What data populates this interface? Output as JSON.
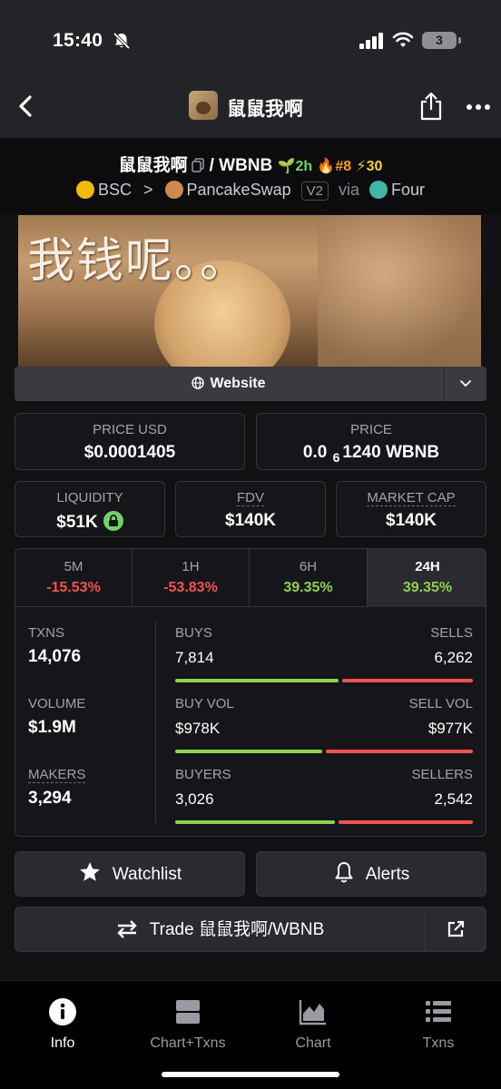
{
  "status_bar": {
    "time": "15:40",
    "battery": "3"
  },
  "nav": {
    "title": "鼠鼠我啊"
  },
  "pair": {
    "token": "鼠鼠我啊",
    "separator": "/",
    "quote": "WBNB",
    "age": "2h",
    "rank": "#8",
    "boosts": "30",
    "chain": "BSC",
    "chevron": ">",
    "dex": "PancakeSwap",
    "dex_version": "V2",
    "via_label": "via",
    "launchpad": "Four"
  },
  "banner": {
    "text": "我钱呢。。"
  },
  "website": {
    "label": "Website"
  },
  "stats": {
    "price_usd_label": "PRICE USD",
    "price_usd": "$0.0001405",
    "price_label": "PRICE",
    "price_prefix": "0.0",
    "price_zeros": "6",
    "price_digits": "1240",
    "price_unit": "WBNB",
    "liquidity_label": "LIQUIDITY",
    "liquidity": "$51K",
    "fdv_label": "FDV",
    "fdv": "$140K",
    "mcap_label": "MARKET CAP",
    "mcap": "$140K"
  },
  "timeframes": [
    {
      "label": "5M",
      "value": "-15.53%",
      "direction": "down"
    },
    {
      "label": "1H",
      "value": "-53.83%",
      "direction": "down"
    },
    {
      "label": "6H",
      "value": "39.35%",
      "direction": "up"
    },
    {
      "label": "24H",
      "value": "39.35%",
      "direction": "up",
      "active": true
    }
  ],
  "txns": {
    "txns_label": "TXNS",
    "txns": "14,076",
    "volume_label": "VOLUME",
    "volume": "$1.9M",
    "makers_label": "MAKERS",
    "makers": "3,294",
    "buys_label": "BUYS",
    "buys": "7,814",
    "sells_label": "SELLS",
    "sells": "6,262",
    "buys_ratio": 0.555,
    "buy_vol_label": "BUY VOL",
    "buy_vol": "$978K",
    "sell_vol_label": "SELL VOL",
    "sell_vol": "$977K",
    "buy_vol_ratio": 0.5,
    "buyers_label": "BUYERS",
    "buyers": "3,026",
    "sellers_label": "SELLERS",
    "sellers": "2,542",
    "buyers_ratio": 0.543
  },
  "actions": {
    "watchlist": "Watchlist",
    "alerts": "Alerts",
    "trade": "Trade 鼠鼠我啊/WBNB"
  },
  "bottom_nav": [
    {
      "label": "Info",
      "icon": "info-icon",
      "active": true
    },
    {
      "label": "Chart+Txns",
      "icon": "split-icon"
    },
    {
      "label": "Chart",
      "icon": "area-chart-icon"
    },
    {
      "label": "Txns",
      "icon": "list-icon"
    }
  ],
  "colors": {
    "positive": "#8fd14f",
    "negative": "#ef5350",
    "background": "#111114"
  }
}
